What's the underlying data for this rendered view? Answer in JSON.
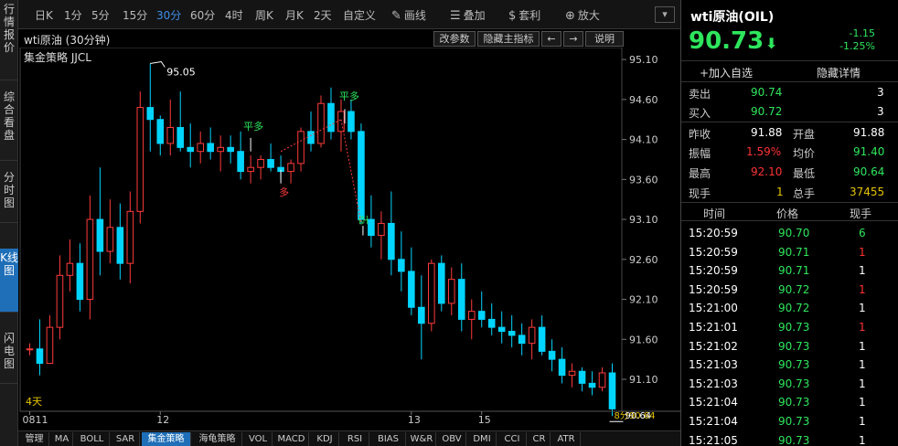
{
  "side_tabs": [
    {
      "label": "行情报价"
    },
    {
      "label": "综合看盘"
    },
    {
      "label": "分时图"
    },
    {
      "label": "K线图"
    },
    {
      "label": "闪电图"
    }
  ],
  "toolbar": {
    "periods": [
      "日K",
      "1分",
      "5分",
      "15分",
      "30分",
      "60分",
      "4时",
      "周K",
      "月K",
      "2天",
      "自定义"
    ],
    "active_period": "30分",
    "draw_line": "画线",
    "overlay": "叠加",
    "arbitrage": "套利",
    "zoom": "放大",
    "icons": [
      "pencil-icon",
      "layers-icon",
      "money-bag-icon",
      "magnifier-icon",
      "chevron-down-icon"
    ]
  },
  "chart_header": {
    "title": "wti原油 (30分钟)",
    "strategy": "集金策略 JJCL",
    "buttons": [
      "改参数",
      "隐藏主指标",
      "←",
      "→",
      "说明"
    ]
  },
  "chart_data": {
    "type": "candlestick",
    "title": "wti原油 (30分钟)",
    "y_ticks": [
      95.1,
      94.6,
      94.1,
      93.6,
      93.1,
      92.6,
      92.1,
      91.6,
      91.1
    ],
    "ylim": [
      90.7,
      95.25
    ],
    "x_tick_labels": [
      "0811",
      "12",
      "13",
      "15"
    ],
    "annotations": [
      "95.05",
      "平多",
      "多",
      "平多",
      "空",
      "8分90.64",
      "90.64"
    ],
    "max_price": "95.05",
    "last_label": "8分90.64",
    "days_label": "4天",
    "candles": [
      [
        91.48,
        91.55,
        91.4,
        91.48
      ],
      [
        91.48,
        91.85,
        91.15,
        91.3
      ],
      [
        91.3,
        91.9,
        91.35,
        91.75
      ],
      [
        91.75,
        92.65,
        91.6,
        92.4
      ],
      [
        92.4,
        92.85,
        92.2,
        92.55
      ],
      [
        92.55,
        92.8,
        91.95,
        92.1
      ],
      [
        92.1,
        93.4,
        91.85,
        93.1
      ],
      [
        93.1,
        93.75,
        92.4,
        92.7
      ],
      [
        92.7,
        93.35,
        92.55,
        93.0
      ],
      [
        93.0,
        93.3,
        92.35,
        92.55
      ],
      [
        92.55,
        93.45,
        92.3,
        93.2
      ],
      [
        93.2,
        94.7,
        93.05,
        94.5
      ],
      [
        94.5,
        95.05,
        93.95,
        94.35
      ],
      [
        94.35,
        94.4,
        93.9,
        94.05
      ],
      [
        94.05,
        94.6,
        93.9,
        94.25
      ],
      [
        94.25,
        94.7,
        93.95,
        94.0
      ],
      [
        94.0,
        94.3,
        93.75,
        93.95
      ],
      [
        93.95,
        94.2,
        93.8,
        94.05
      ],
      [
        94.05,
        94.25,
        93.85,
        93.95
      ],
      [
        93.95,
        94.15,
        93.7,
        94.0
      ],
      [
        94.0,
        94.15,
        93.8,
        93.95
      ],
      [
        93.95,
        94.2,
        93.6,
        93.7
      ],
      [
        93.7,
        93.9,
        93.55,
        93.75
      ],
      [
        93.75,
        93.9,
        93.6,
        93.85
      ],
      [
        93.85,
        94.05,
        93.7,
        93.75
      ],
      [
        93.75,
        93.9,
        93.6,
        93.7
      ],
      [
        93.7,
        93.85,
        93.55,
        93.8
      ],
      [
        93.8,
        94.25,
        93.7,
        94.2
      ],
      [
        94.2,
        94.45,
        93.95,
        94.05
      ],
      [
        94.05,
        94.65,
        94.0,
        94.55
      ],
      [
        94.55,
        94.75,
        94.1,
        94.2
      ],
      [
        94.2,
        94.6,
        93.95,
        94.45
      ],
      [
        94.45,
        94.6,
        94.1,
        94.2
      ],
      [
        94.2,
        94.3,
        93.05,
        93.1
      ],
      [
        93.1,
        93.4,
        92.75,
        92.9
      ],
      [
        92.9,
        93.2,
        92.6,
        93.05
      ],
      [
        93.05,
        93.45,
        92.4,
        92.6
      ],
      [
        92.6,
        92.95,
        92.2,
        92.45
      ],
      [
        92.45,
        92.75,
        91.9,
        92.0
      ],
      [
        92.0,
        92.4,
        91.35,
        91.8
      ],
      [
        91.8,
        92.6,
        91.7,
        92.55
      ],
      [
        92.55,
        92.65,
        91.95,
        92.05
      ],
      [
        92.05,
        92.5,
        91.9,
        92.35
      ],
      [
        92.35,
        92.55,
        91.7,
        91.85
      ],
      [
        91.85,
        92.1,
        91.6,
        91.95
      ],
      [
        91.95,
        92.2,
        91.75,
        91.85
      ],
      [
        91.85,
        92.05,
        91.65,
        91.75
      ],
      [
        91.75,
        91.95,
        91.55,
        91.7
      ],
      [
        91.7,
        91.9,
        91.5,
        91.65
      ],
      [
        91.65,
        91.8,
        91.4,
        91.55
      ],
      [
        91.55,
        91.85,
        91.35,
        91.75
      ],
      [
        91.75,
        91.9,
        91.4,
        91.45
      ],
      [
        91.45,
        91.6,
        91.2,
        91.35
      ],
      [
        91.35,
        91.5,
        91.05,
        91.15
      ],
      [
        91.15,
        91.3,
        91.0,
        91.2
      ],
      [
        91.2,
        91.25,
        90.95,
        91.05
      ],
      [
        91.05,
        91.2,
        90.9,
        91.0
      ],
      [
        91.0,
        91.25,
        90.95,
        91.18
      ],
      [
        91.18,
        91.3,
        90.64,
        90.73
      ]
    ]
  },
  "indicator_tabs": [
    "管理",
    "MA",
    "BOLL",
    "SAR",
    "集金策略",
    "海龟策略",
    "VOL",
    "MACD",
    "KDJ",
    "RSI",
    "BIAS",
    "W&R",
    "OBV",
    "DMI",
    "CCI",
    "CR",
    "ATR"
  ],
  "active_indicator": "集金策略",
  "quote": {
    "title": "wti原油(OIL)",
    "price": "90.73",
    "change": "-1.15",
    "change_pct": "-1.25%",
    "add_fav": "+加入自选",
    "hide_detail": "隐藏详情",
    "sell_label": "卖出",
    "sell_price": "90.74",
    "sell_qty": "3",
    "buy_label": "买入",
    "buy_price": "90.72",
    "buy_qty": "3",
    "prev_close_label": "昨收",
    "prev_close": "91.88",
    "open_label": "开盘",
    "open": "91.88",
    "amp_label": "振幅",
    "amp": "1.59%",
    "avg_label": "均价",
    "avg": "91.40",
    "high_label": "最高",
    "high": "92.10",
    "low_label": "最低",
    "low": "90.64",
    "cur_label": "现手",
    "cur": "1",
    "total_label": "总手",
    "total": "37455"
  },
  "ticks_header": {
    "time": "时间",
    "price": "价格",
    "vol": "现手"
  },
  "ticks": [
    {
      "time": "15:20:59",
      "price": "90.70",
      "vol": "6",
      "up": false
    },
    {
      "time": "15:20:59",
      "price": "90.71",
      "vol": "1",
      "up": true
    },
    {
      "time": "15:20:59",
      "price": "90.71",
      "vol": "1",
      "up": false
    },
    {
      "time": "15:20:59",
      "price": "90.72",
      "vol": "1",
      "up": true
    },
    {
      "time": "15:21:00",
      "price": "90.72",
      "vol": "1",
      "up": false
    },
    {
      "time": "15:21:01",
      "price": "90.73",
      "vol": "1",
      "up": true
    },
    {
      "time": "15:21:02",
      "price": "90.73",
      "vol": "1",
      "up": false
    },
    {
      "time": "15:21:03",
      "price": "90.73",
      "vol": "1",
      "up": false
    },
    {
      "time": "15:21:03",
      "price": "90.73",
      "vol": "1",
      "up": false
    },
    {
      "time": "15:21:04",
      "price": "90.73",
      "vol": "1",
      "up": false
    },
    {
      "time": "15:21:04",
      "price": "90.73",
      "vol": "1",
      "up": false
    },
    {
      "time": "15:21:05",
      "price": "90.73",
      "vol": "1",
      "up": false
    }
  ]
}
